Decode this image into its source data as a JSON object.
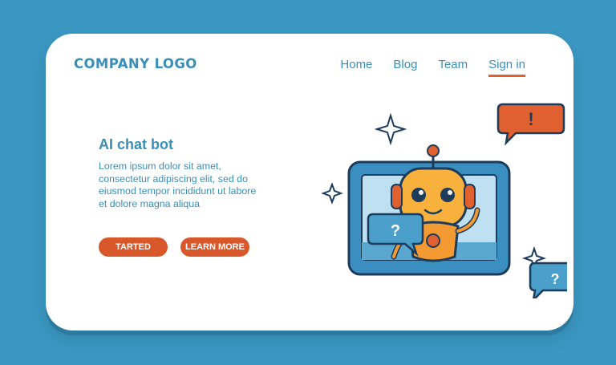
{
  "header": {
    "logo": "COMPANY LOGO",
    "nav": [
      {
        "label": "Home"
      },
      {
        "label": "Blog"
      },
      {
        "label": "Team"
      },
      {
        "label": "Sign in"
      }
    ]
  },
  "hero": {
    "headline": "AI chat bot ",
    "body": "Lorem ipsum dolor sit amet, consectetur adipiscing elit, sed do eiusmod tempor incididunt ut labore et dolore magna aliqua",
    "primary_button": "TARTED",
    "secondary_button": "LEARN MORE"
  },
  "illustration": {
    "bubble_alert": "!",
    "bubble_question_left": "?",
    "bubble_question_right": "?"
  },
  "colors": {
    "background": "#3a97c1",
    "accent": "#d9582b",
    "primary_text": "#3a8fb8"
  },
  "icons": [
    "robot-icon",
    "monitor-icon",
    "sparkle-icon",
    "speech-bubble-icon"
  ]
}
